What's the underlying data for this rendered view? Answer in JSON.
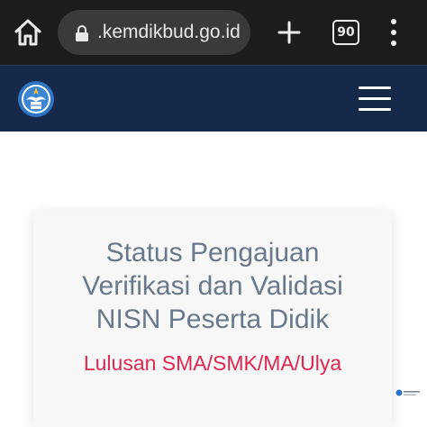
{
  "browser": {
    "url": ".kemdikbud.go.id",
    "tab_count": "90",
    "icons": [
      "home-icon",
      "lock-icon",
      "plus-icon",
      "tab-switcher-icon",
      "more-vertical-icon"
    ]
  },
  "header": {
    "background": "#17294a",
    "logo_icon": "tut-wuri-handayani-logo",
    "menu_icon": "hamburger-menu-icon"
  },
  "card": {
    "title_lines": [
      "Status Pengajuan",
      "Verifikasi dan Validasi",
      "NISN Peserta Didik"
    ],
    "subtitle": "Lulusan SMA/SMK/MA/Ulya",
    "subtitle_color": "#e0274d"
  }
}
